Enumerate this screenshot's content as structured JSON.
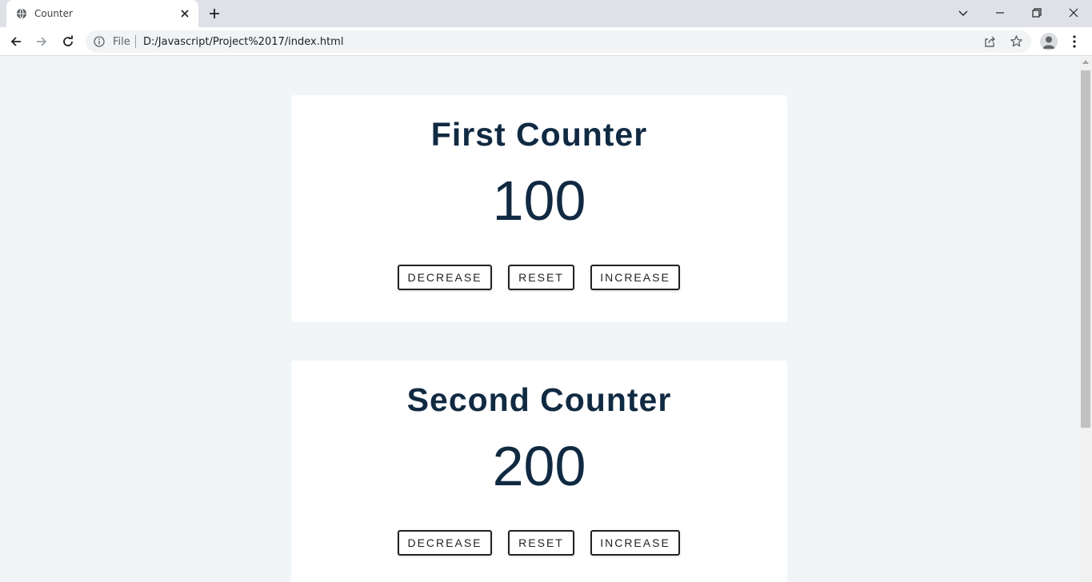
{
  "browser": {
    "tab_title": "Counter",
    "omnibox": {
      "scheme_label": "File",
      "url": "D:/Javascript/Project%2017/index.html"
    }
  },
  "counters": [
    {
      "title": "First Counter",
      "value": "100",
      "buttons": {
        "decrease": "Decrease",
        "reset": "Reset",
        "increase": "Increase"
      }
    },
    {
      "title": "Second Counter",
      "value": "200",
      "buttons": {
        "decrease": "Decrease",
        "reset": "Reset",
        "increase": "Increase"
      }
    }
  ],
  "colors": {
    "page_background": "#f1f5f8",
    "card_background": "#ffffff",
    "heading": "#102a42",
    "button_border": "#222222"
  },
  "icons": {
    "tab": [
      "globe-icon",
      "close-icon",
      "plus-icon"
    ],
    "window": [
      "chevron-down-icon",
      "minimize-icon",
      "restore-icon",
      "close-icon"
    ],
    "toolbar": [
      "back-arrow-icon",
      "forward-arrow-icon",
      "reload-icon",
      "info-icon",
      "share-icon",
      "star-icon",
      "profile-icon",
      "kebab-menu-icon"
    ]
  }
}
